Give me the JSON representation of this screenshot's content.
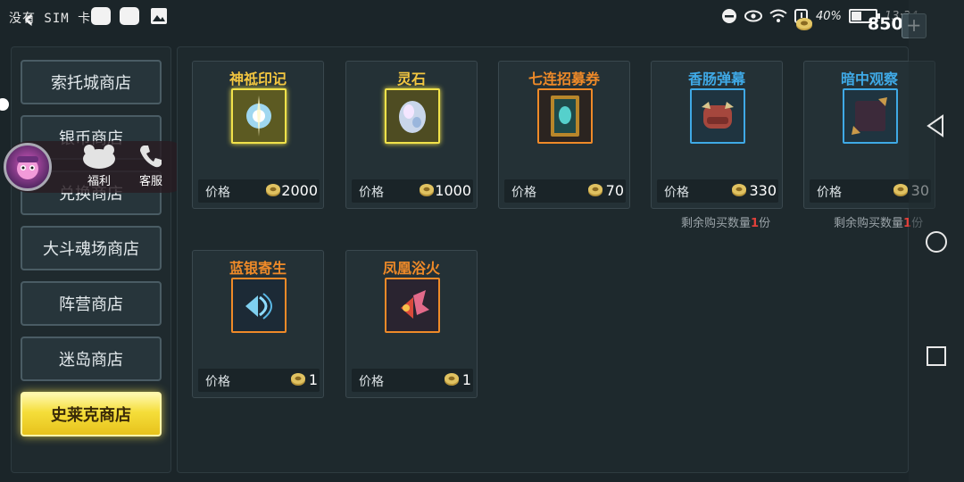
{
  "status_bar": {
    "carrier": "没有 SIM 卡",
    "battery": "40%",
    "time": "13:34"
  },
  "header": {
    "currency_amount": "850",
    "add_label": "+"
  },
  "sidebar": {
    "tabs": [
      {
        "label": "索托城商店"
      },
      {
        "label": "银币商店"
      },
      {
        "label": "兑换商店"
      },
      {
        "label": "大斗魂场商店"
      },
      {
        "label": "阵营商店"
      },
      {
        "label": "迷岛商店"
      },
      {
        "label": "史莱克商店"
      }
    ],
    "active_index": 6
  },
  "float_menu": {
    "welfare": "福利",
    "service": "客服"
  },
  "price_label": "价格",
  "items": [
    {
      "name": "神祗印记",
      "price": "2000",
      "name_color": "#f3c640",
      "frame": "#f1e24a",
      "icon": "glowing-orb-icon"
    },
    {
      "name": "灵石",
      "price": "1000",
      "name_color": "#f3c640",
      "frame": "#f1e24a",
      "icon": "spirit-stone-icon"
    },
    {
      "name": "七连招募券",
      "price": "70",
      "name_color": "#ef8a28",
      "frame": "#ef8a28",
      "icon": "recruit-ticket-icon"
    },
    {
      "name": "香肠弹幕",
      "price": "330",
      "name_color": "#3fa9e6",
      "frame": "#3fa9e6",
      "icon": "sausage-icon",
      "remaining": {
        "prefix": "剩余购买数量",
        "count": "1",
        "suffix": "份"
      }
    },
    {
      "name": "暗中观察",
      "price": "30",
      "name_color": "#3fa9e6",
      "frame": "#3fa9e6",
      "icon": "peek-frame-icon",
      "remaining": {
        "prefix": "剩余购买数量",
        "count": "1",
        "suffix": "份"
      }
    },
    {
      "name": "蓝银寄生",
      "price": "1",
      "name_color": "#ef8a28",
      "frame": "#ef8a28",
      "icon": "blue-silver-icon"
    },
    {
      "name": "凤凰浴火",
      "price": "1",
      "name_color": "#ef8a28",
      "frame": "#ef8a28",
      "icon": "phoenix-icon"
    }
  ]
}
